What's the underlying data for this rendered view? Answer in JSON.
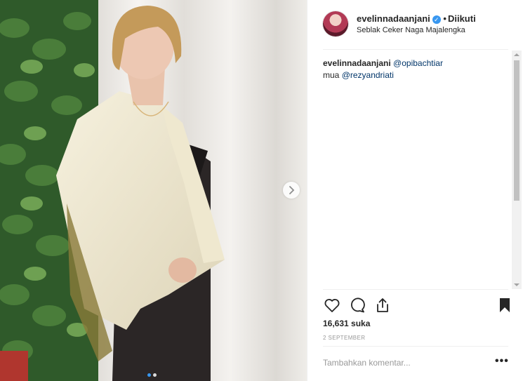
{
  "post": {
    "username": "evelinnadaanjani",
    "follow_status": "Diikuti",
    "location": "Seblak Ceker Naga Majalengka",
    "caption_user": "evelinnadaanjani",
    "caption_mention_1": "@opibachtiar",
    "caption_prefix_2": "mua ",
    "caption_mention_2": "@rezyandriati",
    "likes": "16,631 suka",
    "date": "2 SEPTEMBER",
    "comment_placeholder": "Tambahkan komentar...",
    "more_label": "•••"
  },
  "icons": {
    "verified": "verified-badge-icon",
    "like": "heart-icon",
    "comment": "comment-bubble-icon",
    "share": "share-icon",
    "save": "bookmark-icon",
    "next": "chevron-right-icon"
  },
  "carousel": {
    "total_slides": 2,
    "active_slide": 1
  },
  "colors": {
    "mention": "#003569",
    "verified": "#3897f0",
    "text": "#262626",
    "muted": "#999999"
  }
}
